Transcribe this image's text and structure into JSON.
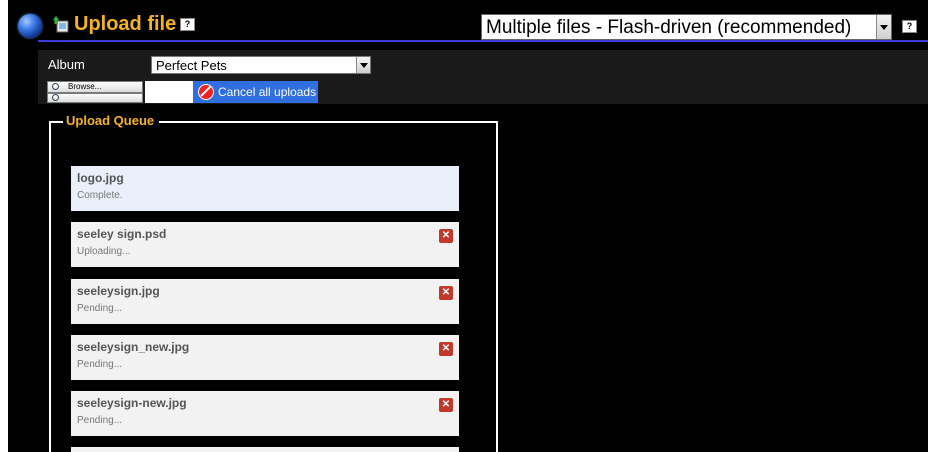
{
  "header": {
    "title": "Upload file",
    "help": "?",
    "mode_select": {
      "selected": "Multiple files - Flash-driven (recommended)"
    },
    "mode_help": "?"
  },
  "form": {
    "album_label": "Album",
    "album_select": {
      "selected": "Perfect Pets"
    },
    "browse_label": "Browse...",
    "cancel_all_label": "Cancel all uploads"
  },
  "queue": {
    "legend": "Upload Queue",
    "items": [
      {
        "name": "logo.jpg",
        "status": "Complete."
      },
      {
        "name": "seeley sign.psd",
        "status": "Uploading..."
      },
      {
        "name": "seeleysign.jpg",
        "status": "Pending..."
      },
      {
        "name": "seeleysign_new.jpg",
        "status": "Pending..."
      },
      {
        "name": "seeleysign-new.jpg",
        "status": "Pending..."
      }
    ],
    "cancel_glyph": "✕"
  },
  "colors": {
    "accent": "#f5b321",
    "button_blue": "#2f6fe0",
    "header_line": "#3b3bd6"
  }
}
